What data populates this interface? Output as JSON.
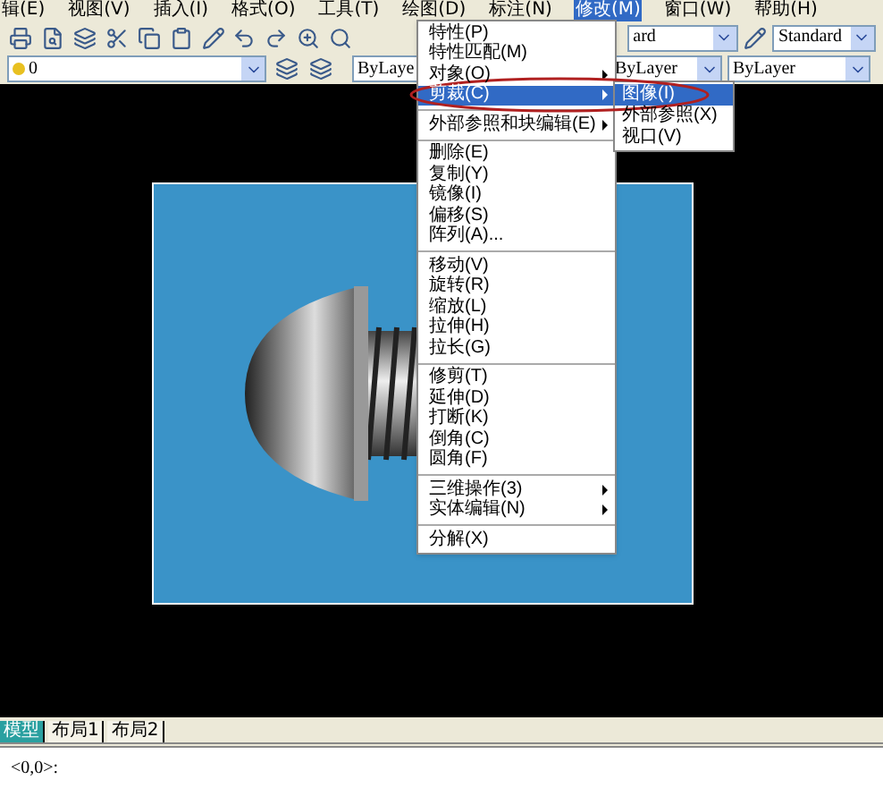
{
  "menubar": [
    {
      "label": "辑(E)",
      "selected": false
    },
    {
      "label": "视图(V)",
      "selected": false
    },
    {
      "label": "插入(I)",
      "selected": false
    },
    {
      "label": "格式(O)",
      "selected": false
    },
    {
      "label": "工具(T)",
      "selected": false
    },
    {
      "label": "绘图(D)",
      "selected": false
    },
    {
      "label": "标注(N)",
      "selected": false
    },
    {
      "label": "修改(M)",
      "selected": true
    },
    {
      "label": "窗口(W)",
      "selected": false
    },
    {
      "label": "帮助(H)",
      "selected": false
    }
  ],
  "toolbar_1": {
    "style_dropdown_1": "ard",
    "style_dropdown_2": "Standard"
  },
  "toolbar_2": {
    "layer_dropdown": "0",
    "color_dropdown": "ByLaye",
    "linetype_dropdown": "ByLayer",
    "lineweight_dropdown": "ByLayer"
  },
  "menu": [
    {
      "kind": "item",
      "label": "特性(P)",
      "submenu": false,
      "selected": false
    },
    {
      "kind": "item",
      "label": "特性匹配(M)",
      "submenu": false,
      "selected": false
    },
    {
      "kind": "item",
      "label": "对象(O)",
      "submenu": true,
      "selected": false
    },
    {
      "kind": "item",
      "label": "剪裁(C)",
      "submenu": true,
      "selected": true
    },
    {
      "kind": "separator"
    },
    {
      "kind": "item",
      "label": "外部参照和块编辑(E)",
      "submenu": true,
      "selected": false
    },
    {
      "kind": "separator"
    },
    {
      "kind": "item",
      "label": "删除(E)",
      "submenu": false,
      "selected": false
    },
    {
      "kind": "item",
      "label": "复制(Y)",
      "submenu": false,
      "selected": false
    },
    {
      "kind": "item",
      "label": "镜像(I)",
      "submenu": false,
      "selected": false
    },
    {
      "kind": "item",
      "label": "偏移(S)",
      "submenu": false,
      "selected": false
    },
    {
      "kind": "item",
      "label": "阵列(A)...",
      "submenu": false,
      "selected": false
    },
    {
      "kind": "separator"
    },
    {
      "kind": "item",
      "label": "移动(V)",
      "submenu": false,
      "selected": false
    },
    {
      "kind": "item",
      "label": "旋转(R)",
      "submenu": false,
      "selected": false
    },
    {
      "kind": "item",
      "label": "缩放(L)",
      "submenu": false,
      "selected": false
    },
    {
      "kind": "item",
      "label": "拉伸(H)",
      "submenu": false,
      "selected": false
    },
    {
      "kind": "item",
      "label": "拉长(G)",
      "submenu": false,
      "selected": false
    },
    {
      "kind": "separator"
    },
    {
      "kind": "item",
      "label": "修剪(T)",
      "submenu": false,
      "selected": false
    },
    {
      "kind": "item",
      "label": "延伸(D)",
      "submenu": false,
      "selected": false
    },
    {
      "kind": "item",
      "label": "打断(K)",
      "submenu": false,
      "selected": false
    },
    {
      "kind": "item",
      "label": "倒角(C)",
      "submenu": false,
      "selected": false
    },
    {
      "kind": "item",
      "label": "圆角(F)",
      "submenu": false,
      "selected": false
    },
    {
      "kind": "separator"
    },
    {
      "kind": "item",
      "label": "三维操作(3)",
      "submenu": true,
      "selected": false
    },
    {
      "kind": "item",
      "label": "实体编辑(N)",
      "submenu": true,
      "selected": false
    },
    {
      "kind": "separator"
    },
    {
      "kind": "item",
      "label": "分解(X)",
      "submenu": false,
      "selected": false
    }
  ],
  "submenu": [
    {
      "label": "图像(I)",
      "selected": true
    },
    {
      "label": "外部参照(X)",
      "selected": false
    },
    {
      "label": "视口(V)",
      "selected": false
    }
  ],
  "layout_tabs": [
    {
      "label": "模型",
      "selected": true
    },
    {
      "label": "布局1",
      "selected": false
    },
    {
      "label": "布局2",
      "selected": false
    }
  ],
  "command_line": "<0,0>:"
}
